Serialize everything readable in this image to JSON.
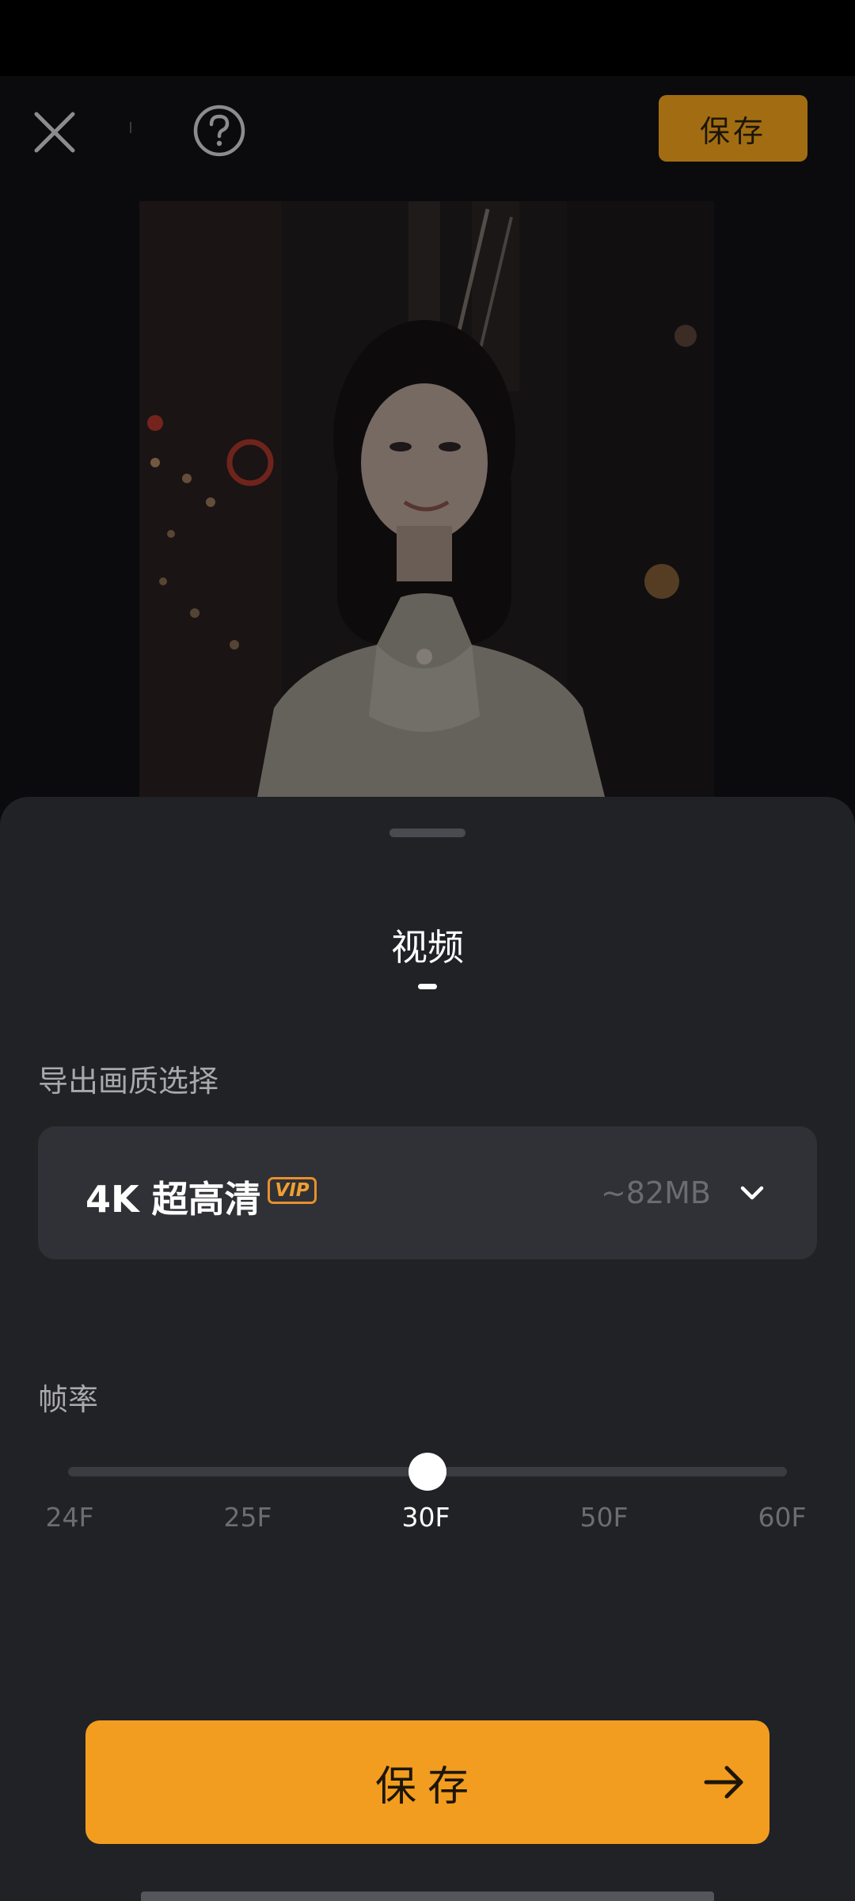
{
  "toolbar": {
    "close_icon": "close-icon",
    "help_icon": "question-circle-icon",
    "save_label": "保存",
    "accent_dim": "#a26d12"
  },
  "sheet": {
    "tab_title": "视频",
    "quality": {
      "label": "导出画质选择",
      "selected": "4K 超高清",
      "badge": "VIP",
      "size": "~82MB"
    },
    "frame_rate": {
      "label": "帧率",
      "options": [
        "24F",
        "25F",
        "30F",
        "50F",
        "60F"
      ],
      "selected_index": 2,
      "selected_value": "30F"
    },
    "save_button": {
      "label": "保存",
      "icon": "arrow-right-icon",
      "color": "#f29d1f"
    }
  }
}
